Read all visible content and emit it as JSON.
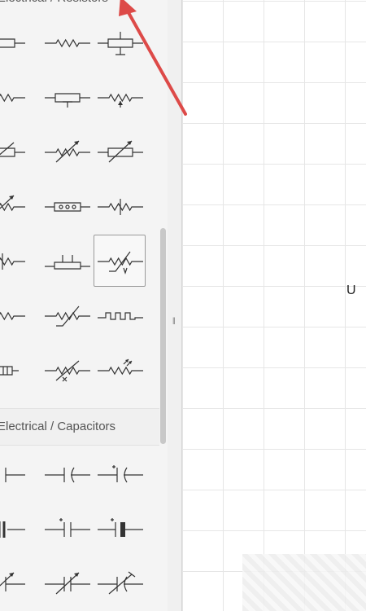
{
  "sidebar": {
    "resistors_header": "Electrical / Resistors",
    "capacitors_header": "Electrical / Capacitors"
  },
  "canvas": {
    "label": "U"
  },
  "colors": {
    "arrow": "#dd4a48",
    "selection_border": "#9a9a9a",
    "grid": "#e6e6e6"
  },
  "shapes": {
    "resistors": [
      "resistor-box-icon",
      "resistor-zigzag-icon",
      "resistor-tapped-box-icon",
      "resistor-zigzag-icon",
      "potentiometer-box-icon",
      "potentiometer-zigzag-icon",
      "variable-resistor-box-icon",
      "variable-resistor-zigzag-icon",
      "variable-resistor-box-arrow-icon",
      "variable-resistor-zigzag-arrow-icon",
      "resistor-network-icon",
      "resistor-zigzag-tap-icon",
      "resistor-zigzag-tap-icon",
      "trimmer-box-icon",
      "thermistor-zigzag-icon",
      "resistor-zigzag-icon",
      "varistor-zigzag-icon",
      "resistor-meander-icon",
      "resistor-ladder-icon",
      "varistor-x-icon",
      "photoresistor-icon"
    ],
    "capacitors": [
      "capacitor-icon",
      "capacitor-polarized-icon",
      "capacitor-electrolytic-icon",
      "capacitor-double-icon",
      "capacitor-plus-icon",
      "capacitor-plus-block-icon",
      "capacitor-variable-icon",
      "capacitor-variable-icon",
      "capacitor-trimmer-icon"
    ]
  }
}
